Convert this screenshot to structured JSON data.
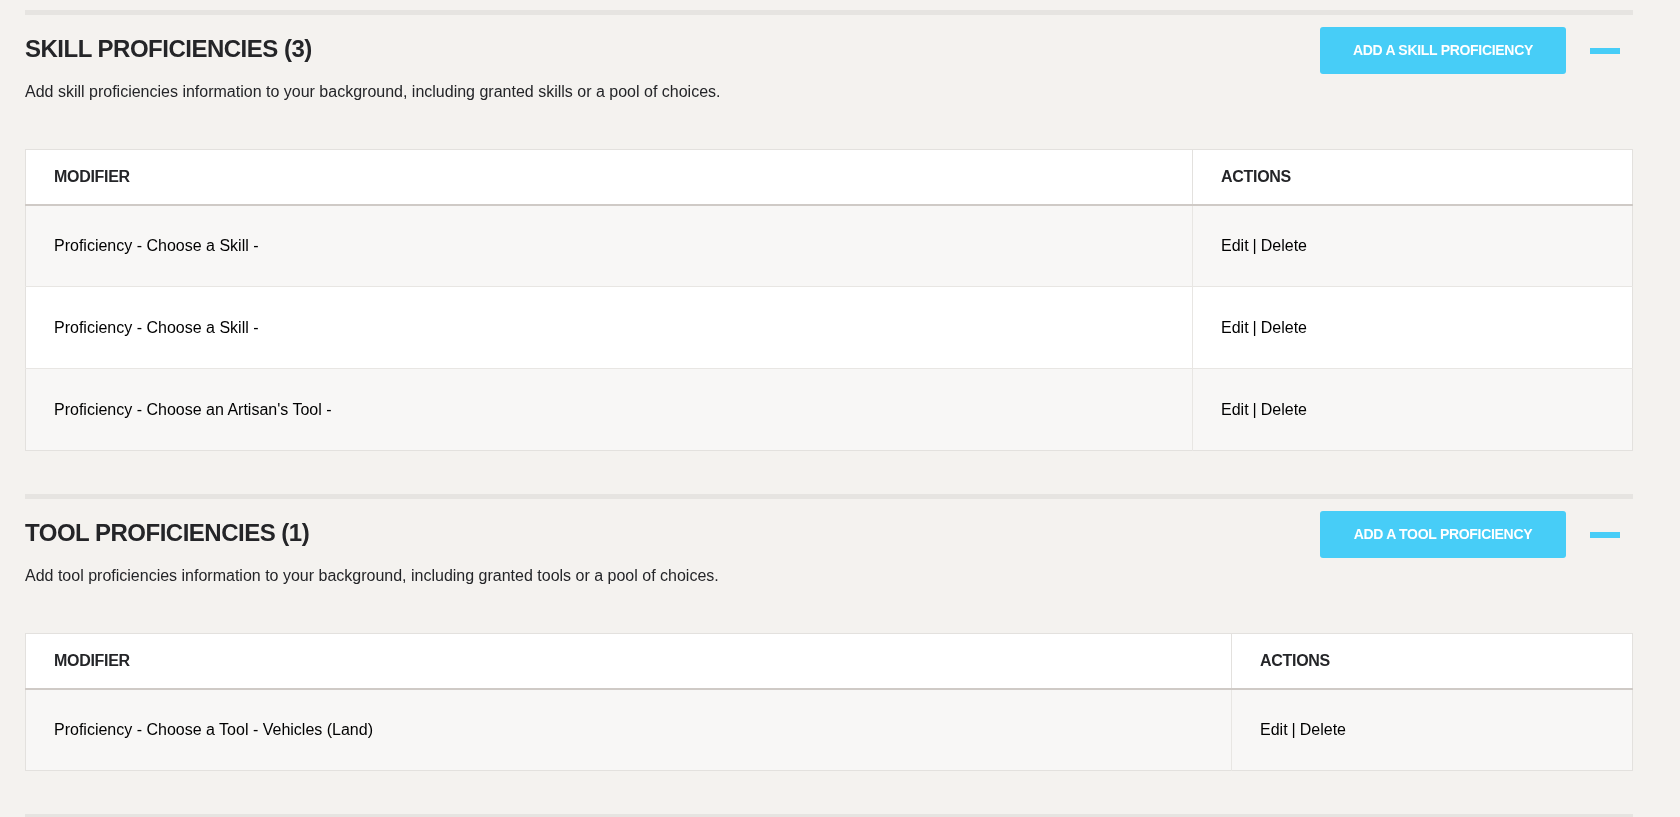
{
  "sections": [
    {
      "title": "SKILL PROFICIENCIES (3)",
      "description": "Add skill proficiencies information to your background, including granted skills or a pool of choices.",
      "button": "ADD A SKILL PROFICIENCY",
      "expanded": true,
      "columns": [
        "MODIFIER",
        "ACTIONS"
      ],
      "rows": [
        {
          "modifier": "Proficiency - Choose a Skill -",
          "edit": "Edit",
          "separator": "|",
          "delete": "Delete"
        },
        {
          "modifier": "Proficiency - Choose a Skill -",
          "edit": "Edit",
          "separator": "|",
          "delete": "Delete"
        },
        {
          "modifier": "Proficiency - Choose an Artisan's Tool -",
          "edit": "Edit",
          "separator": "|",
          "delete": "Delete"
        }
      ]
    },
    {
      "title": "TOOL PROFICIENCIES (1)",
      "description": "Add tool proficiencies information to your background, including granted tools or a pool of choices.",
      "button": "ADD A TOOL PROFICIENCY",
      "expanded": true,
      "columns": [
        "MODIFIER",
        "ACTIONS"
      ],
      "rows": [
        {
          "modifier": "Proficiency - Choose a Tool - Vehicles (Land)",
          "edit": "Edit",
          "separator": "|",
          "delete": "Delete"
        }
      ]
    }
  ]
}
